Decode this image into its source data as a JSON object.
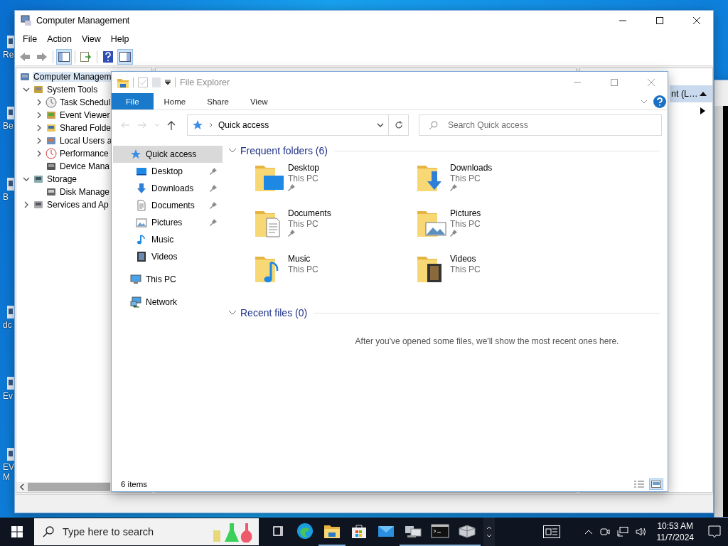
{
  "desktop": {
    "icons": [
      {
        "label": "Re"
      },
      {
        "label": "Be"
      },
      {
        "label": "B"
      },
      {
        "label": "dc"
      },
      {
        "label": "Ev"
      },
      {
        "label": "EV M"
      }
    ]
  },
  "computer_management": {
    "title": "Computer Management",
    "menu": [
      "File",
      "Action",
      "View",
      "Help"
    ],
    "toolbar": [
      {
        "kind": "back",
        "disabled": true,
        "pressed": false
      },
      {
        "kind": "forward",
        "disabled": true,
        "pressed": false
      },
      {
        "kind": "console-tree",
        "pressed": true
      },
      {
        "kind": "export",
        "pressed": false
      },
      {
        "kind": "help",
        "pressed": false
      },
      {
        "kind": "action-pane",
        "pressed": true
      }
    ],
    "tree": [
      {
        "label": "Computer Managem",
        "kind": "computer",
        "selected": true,
        "children": [
          {
            "label": "System Tools",
            "kind": "tools",
            "selected": false,
            "expanded": true,
            "children": [
              {
                "label": "Task Schedul",
                "kind": "clock",
                "selected": false,
                "expanded": false
              },
              {
                "label": "Event Viewer",
                "kind": "viewer",
                "selected": false,
                "expanded": false
              },
              {
                "label": "Shared Folde",
                "kind": "share",
                "selected": false,
                "expanded": false
              },
              {
                "label": "Local Users a",
                "kind": "users",
                "selected": false,
                "expanded": false
              },
              {
                "label": "Performance",
                "kind": "perf",
                "selected": false,
                "expanded": false
              },
              {
                "label": "Device Mana",
                "kind": "device",
                "selected": false
              }
            ]
          },
          {
            "label": "Storage",
            "kind": "storage",
            "selected": false,
            "expanded": true,
            "children": [
              {
                "label": "Disk Manage",
                "kind": "disk",
                "selected": false
              }
            ]
          },
          {
            "label": "Services and Ap",
            "kind": "services",
            "selected": false,
            "expanded": false
          }
        ]
      }
    ],
    "actions": {
      "header": "nt (L…",
      "expanded": true
    }
  },
  "file_explorer": {
    "title": "File Explorer",
    "tabs": [
      {
        "label": "File",
        "kind": "file",
        "selected": false
      },
      {
        "label": "Home",
        "kind": "plain",
        "selected": false
      },
      {
        "label": "Share",
        "kind": "plain",
        "selected": false
      },
      {
        "label": "View",
        "kind": "plain",
        "selected": false
      }
    ],
    "address": {
      "path": "Quick access"
    },
    "search": {
      "placeholder": "Search Quick access"
    },
    "nav": [
      {
        "label": "Quick access",
        "kind": "star",
        "selected": true,
        "children": [
          {
            "label": "Desktop",
            "kind": "desktop",
            "selected": false,
            "pinned": true
          },
          {
            "label": "Downloads",
            "kind": "downloads",
            "selected": false,
            "pinned": true
          },
          {
            "label": "Documents",
            "kind": "documents",
            "selected": false,
            "pinned": true
          },
          {
            "label": "Pictures",
            "kind": "pictures",
            "selected": false,
            "pinned": true
          },
          {
            "label": "Music",
            "kind": "music",
            "selected": false,
            "pinned": false
          },
          {
            "label": "Videos",
            "kind": "videos",
            "selected": false,
            "pinned": false
          }
        ]
      },
      {
        "label": "This PC",
        "kind": "pc",
        "selected": false
      },
      {
        "label": "Network",
        "kind": "network",
        "selected": false
      }
    ],
    "sections": [
      {
        "title": "Frequent folders (6)",
        "expanded": true,
        "folders": [
          {
            "name": "Desktop",
            "location": "This PC",
            "kind": "desktop",
            "pinned": true
          },
          {
            "name": "Downloads",
            "location": "This PC",
            "kind": "downloads",
            "pinned": true
          },
          {
            "name": "Documents",
            "location": "This PC",
            "kind": "documents",
            "pinned": true
          },
          {
            "name": "Pictures",
            "location": "This PC",
            "kind": "pictures",
            "pinned": true
          },
          {
            "name": "Music",
            "location": "This PC",
            "kind": "music",
            "pinned": false
          },
          {
            "name": "Videos",
            "location": "This PC",
            "kind": "videos",
            "pinned": false
          }
        ]
      },
      {
        "title": "Recent files (0)",
        "expanded": true,
        "message": "After you've opened some files, we'll show the most recent ones here."
      }
    ],
    "status": {
      "count": "6 items"
    },
    "views": [
      {
        "kind": "details",
        "selected": false
      },
      {
        "kind": "large-icons",
        "selected": true
      }
    ]
  },
  "taskbar": {
    "search": {
      "placeholder": "Type here to search"
    },
    "apps": [
      {
        "kind": "task-view",
        "running": false
      },
      {
        "kind": "edge",
        "running": false
      },
      {
        "kind": "explorer",
        "running": true
      },
      {
        "kind": "store",
        "running": false
      },
      {
        "kind": "mail",
        "running": false
      },
      {
        "kind": "computers",
        "running": true
      },
      {
        "kind": "terminal",
        "running": true
      },
      {
        "kind": "viewer-3d",
        "running": true
      }
    ],
    "clock": {
      "time": "10:53 AM",
      "date": "11/7/2024"
    }
  }
}
